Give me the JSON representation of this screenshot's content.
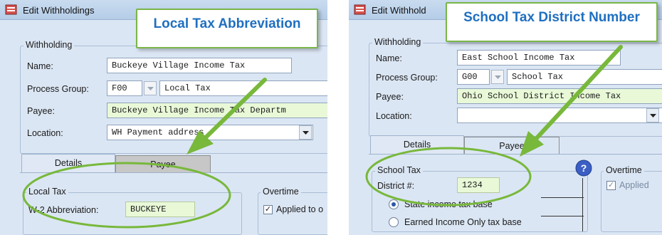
{
  "left": {
    "window_title": "Edit Withholdings",
    "callout": "Local Tax Abbreviation",
    "withholding": {
      "legend": "Withholding",
      "name_label": "Name:",
      "name_value": "Buckeye Village Income Tax",
      "process_group_label": "Process Group:",
      "process_group_code": "F00",
      "process_group_value": "Local Tax",
      "payee_label": "Payee:",
      "payee_value": "Buckeye Village Income Tax Departm",
      "location_label": "Location:",
      "location_value": "WH Payment address"
    },
    "tabs": [
      "Details",
      "Payee"
    ],
    "local_tax": {
      "legend": "Local Tax",
      "abbr_label": "W-2 Abbreviation:",
      "abbr_value": "BUCKEYE"
    },
    "overtime": {
      "legend": "Overtime",
      "applied_label": "Applied to o",
      "applied_checked": true
    }
  },
  "right": {
    "window_title": "Edit Withhold",
    "callout": "School Tax District Number",
    "withholding": {
      "legend": "Withholding",
      "name_label": "Name:",
      "name_value": "East School Income Tax",
      "process_group_label": "Process Group:",
      "process_group_code": "G00",
      "process_group_value": "School Tax",
      "payee_label": "Payee:",
      "payee_value": "Ohio School District Income Tax",
      "location_label": "Location:",
      "location_value": ""
    },
    "tabs": [
      "Details",
      "Payee"
    ],
    "school_tax": {
      "legend": "School Tax",
      "district_label": "District #:",
      "district_value": "1234",
      "radio_state": "State income tax base",
      "radio_earned": "Earned Income Only tax base",
      "selected": "state"
    },
    "overtime": {
      "legend": "Overtime",
      "applied_label": "Applied",
      "applied_checked": true
    }
  },
  "colors": {
    "callout_border": "#7ab648",
    "callout_text": "#1f6fc0",
    "annotation_green": "#78b83b",
    "highlight_field": "#e9f9d8",
    "window_bg": "#dbe6f4"
  }
}
